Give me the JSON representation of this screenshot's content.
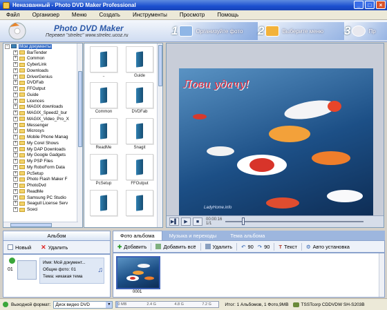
{
  "window": {
    "title": "Неназванный - Photo DVD Maker Professional"
  },
  "menu": [
    "Файл",
    "Организер",
    "Меню",
    "Создать",
    "Инструменты",
    "Просмотр",
    "Помощь"
  ],
  "brand": {
    "name": "Photo DVD Maker",
    "subtitle": "Перевел \"strelec\" www.strelec.ucoz.ru"
  },
  "steps": [
    {
      "num": "1",
      "label": "Организуйте фото",
      "icon": "photo-step-icon"
    },
    {
      "num": "2",
      "label": "Выберите меню",
      "icon": "menu-step-icon"
    },
    {
      "num": "3",
      "label": "Пр",
      "icon": "disc-step-icon"
    }
  ],
  "tree": {
    "root": "Мои документы",
    "items": [
      "BarTender",
      "Common",
      "CyberLink",
      "Downloads",
      "DriverGenius",
      "DVDFab",
      "FFOutput",
      "Guide",
      "Licences",
      "MAGIX downloads",
      "MAGIX_Speed2_bur",
      "MAGIX_Video_Pro_X",
      "Messenger",
      "Microsys",
      "Mobile Phone Manag",
      "My Corel Shows",
      "My DAP Downloads",
      "My Google Gadgets",
      "My PSP Files",
      "My RoboForm Data",
      "PcSetup",
      "Photo Flash Maker F",
      "PhotoDvd",
      "ReadMe",
      "Samsung PC Studio",
      "Seagull License Serv",
      "Sceci"
    ],
    "scroll_fraction": 0.35
  },
  "grid": [
    "..",
    "Guide",
    "Common",
    "DVDFab",
    "ReadMe",
    "Snagit",
    "PcSetup",
    "FFOutput",
    "",
    ""
  ],
  "preview": {
    "title": "Лови удачу!",
    "watermark": "LadyHome.info",
    "time_label": "00:00:16",
    "time_total": "1/1",
    "seek_position": 0.12
  },
  "album_panel": {
    "tab": "Альбом",
    "new_label": "Новый",
    "delete_label": "Удалить",
    "item": {
      "index": "01",
      "name": "Имя: Мой документ...",
      "photos": "Общие фото: 01",
      "theme": "Тема: никакая тема"
    }
  },
  "photo_tabs": [
    "Фото альбома",
    "Музыка и переходы",
    "Тема альбома"
  ],
  "photo_toolbar": [
    "Добавить",
    "Добавить всё",
    "Удалить",
    "90",
    "90",
    "Текст",
    "Авто установка"
  ],
  "photos": [
    {
      "caption": "0001"
    }
  ],
  "status": {
    "format_label": "Выходной формат:",
    "format_value": "Диск видео DVD",
    "capacity_ticks": [
      "0 MB",
      "2.4 G",
      "4.8 G",
      "7.2 G"
    ],
    "capacity_used_fraction": 0.02,
    "summary": "Итог: 1 Альбомов, 1 Фото,9MB",
    "drive": "TSSTcorp CDDVDW SH-S203B"
  }
}
